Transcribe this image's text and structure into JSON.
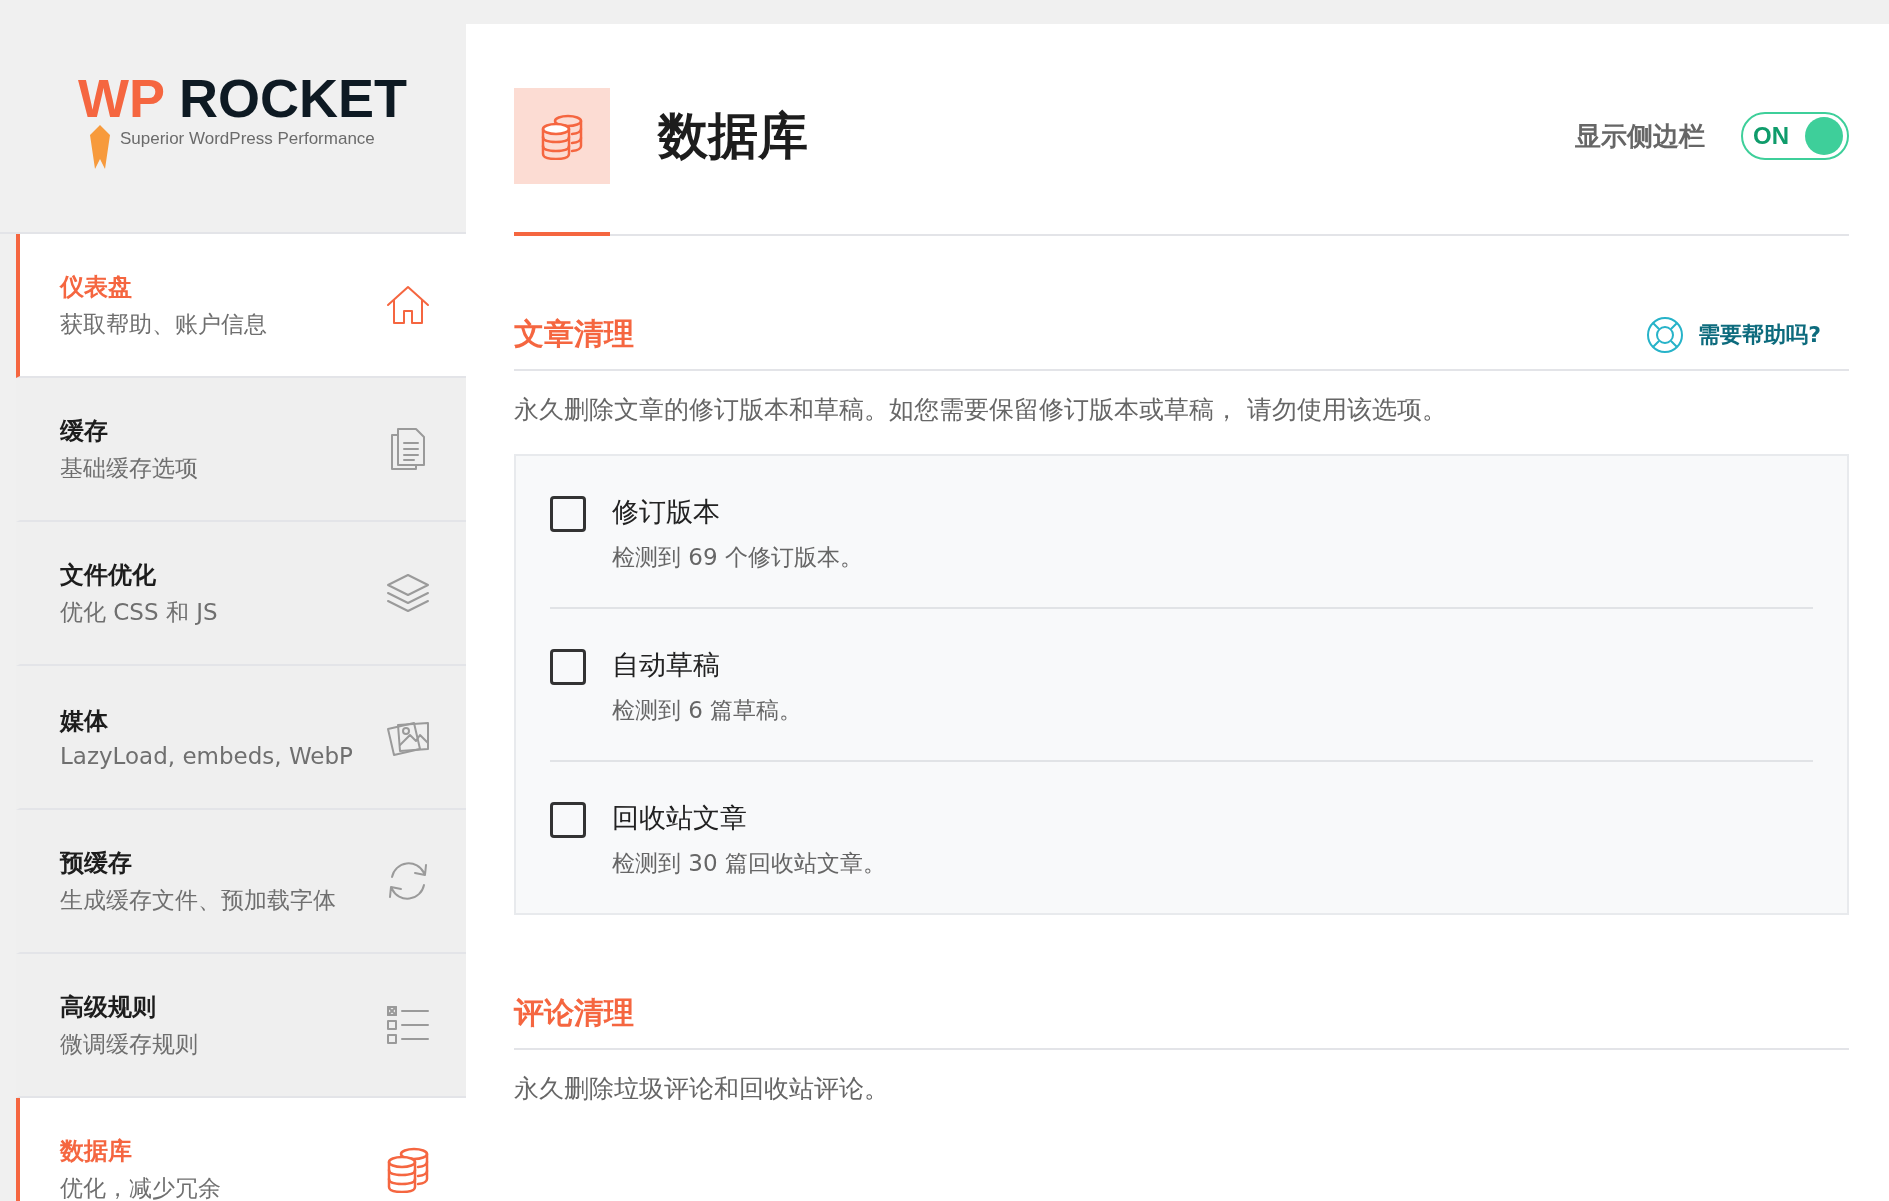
{
  "logo": {
    "accent": "WP",
    "brand": "ROCKET",
    "tagline": "Superior WordPress Performance"
  },
  "sidebar": {
    "items": [
      {
        "title": "仪表盘",
        "subtitle": "获取帮助、账户信息",
        "kind": "home",
        "selected": true
      },
      {
        "title": "缓存",
        "subtitle": "基础缓存选项",
        "kind": "file",
        "selected": false
      },
      {
        "title": "文件优化",
        "subtitle": "优化 CSS 和 JS",
        "kind": "layers",
        "selected": false
      },
      {
        "title": "媒体",
        "subtitle": "LazyLoad, embeds, WebP",
        "kind": "images",
        "selected": false
      },
      {
        "title": "预缓存",
        "subtitle": "生成缓存文件、预加载字体",
        "kind": "refresh",
        "selected": false
      },
      {
        "title": "高级规则",
        "subtitle": "微调缓存规则",
        "kind": "list",
        "selected": false
      },
      {
        "title": "数据库",
        "subtitle": "优化，减少冗余",
        "kind": "database",
        "selected": true
      }
    ]
  },
  "header": {
    "title": "数据库",
    "toggle_label": "显示侧边栏",
    "toggle_text": "ON",
    "toggle_on": true
  },
  "sections": [
    {
      "title": "文章清理",
      "help_link": "需要帮助吗?",
      "description": "永久删除文章的修订版本和草稿。如您需要保留修订版本或草稿， 请勿使用该选项。",
      "options": [
        {
          "label": "修订版本",
          "detail": "检测到 69 个修订版本。",
          "checked": false
        },
        {
          "label": "自动草稿",
          "detail": "检测到 6 篇草稿。",
          "checked": false
        },
        {
          "label": "回收站文章",
          "detail": "检测到 30 篇回收站文章。",
          "checked": false
        }
      ]
    },
    {
      "title": "评论清理",
      "description": "永久删除垃圾评论和回收站评论。"
    }
  ]
}
